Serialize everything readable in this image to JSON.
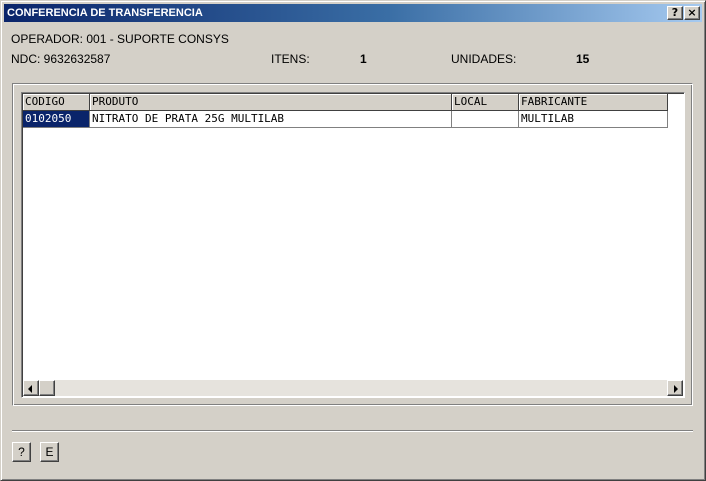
{
  "window": {
    "title": "CONFERENCIA DE TRANSFERENCIA",
    "help_label": "?",
    "close_label": "×"
  },
  "info": {
    "operator": "OPERADOR: 001 - SUPORTE CONSYS",
    "ndc": "NDC: 9632632587",
    "itens_label": "ITENS:",
    "itens_value": "1",
    "unidades_label": "UNIDADES:",
    "unidades_value": "15"
  },
  "table": {
    "columns": [
      "CODIGO",
      "PRODUTO",
      "LOCAL",
      "FABRICANTE"
    ],
    "rows": [
      {
        "codigo": "0102050",
        "produto": "NITRATO DE PRATA 25G MULTILAB",
        "local": "",
        "fabricante": "MULTILAB"
      }
    ],
    "selected_row": 0
  },
  "scrollbar": {
    "left_icon": "arrow-left-icon",
    "right_icon": "arrow-right-icon"
  },
  "buttons": {
    "help": "?",
    "e": "E"
  },
  "colors": {
    "title_start": "#0a246a",
    "title_end": "#a6caf0",
    "selection": "#0a246a",
    "face": "#d4d0c8"
  }
}
